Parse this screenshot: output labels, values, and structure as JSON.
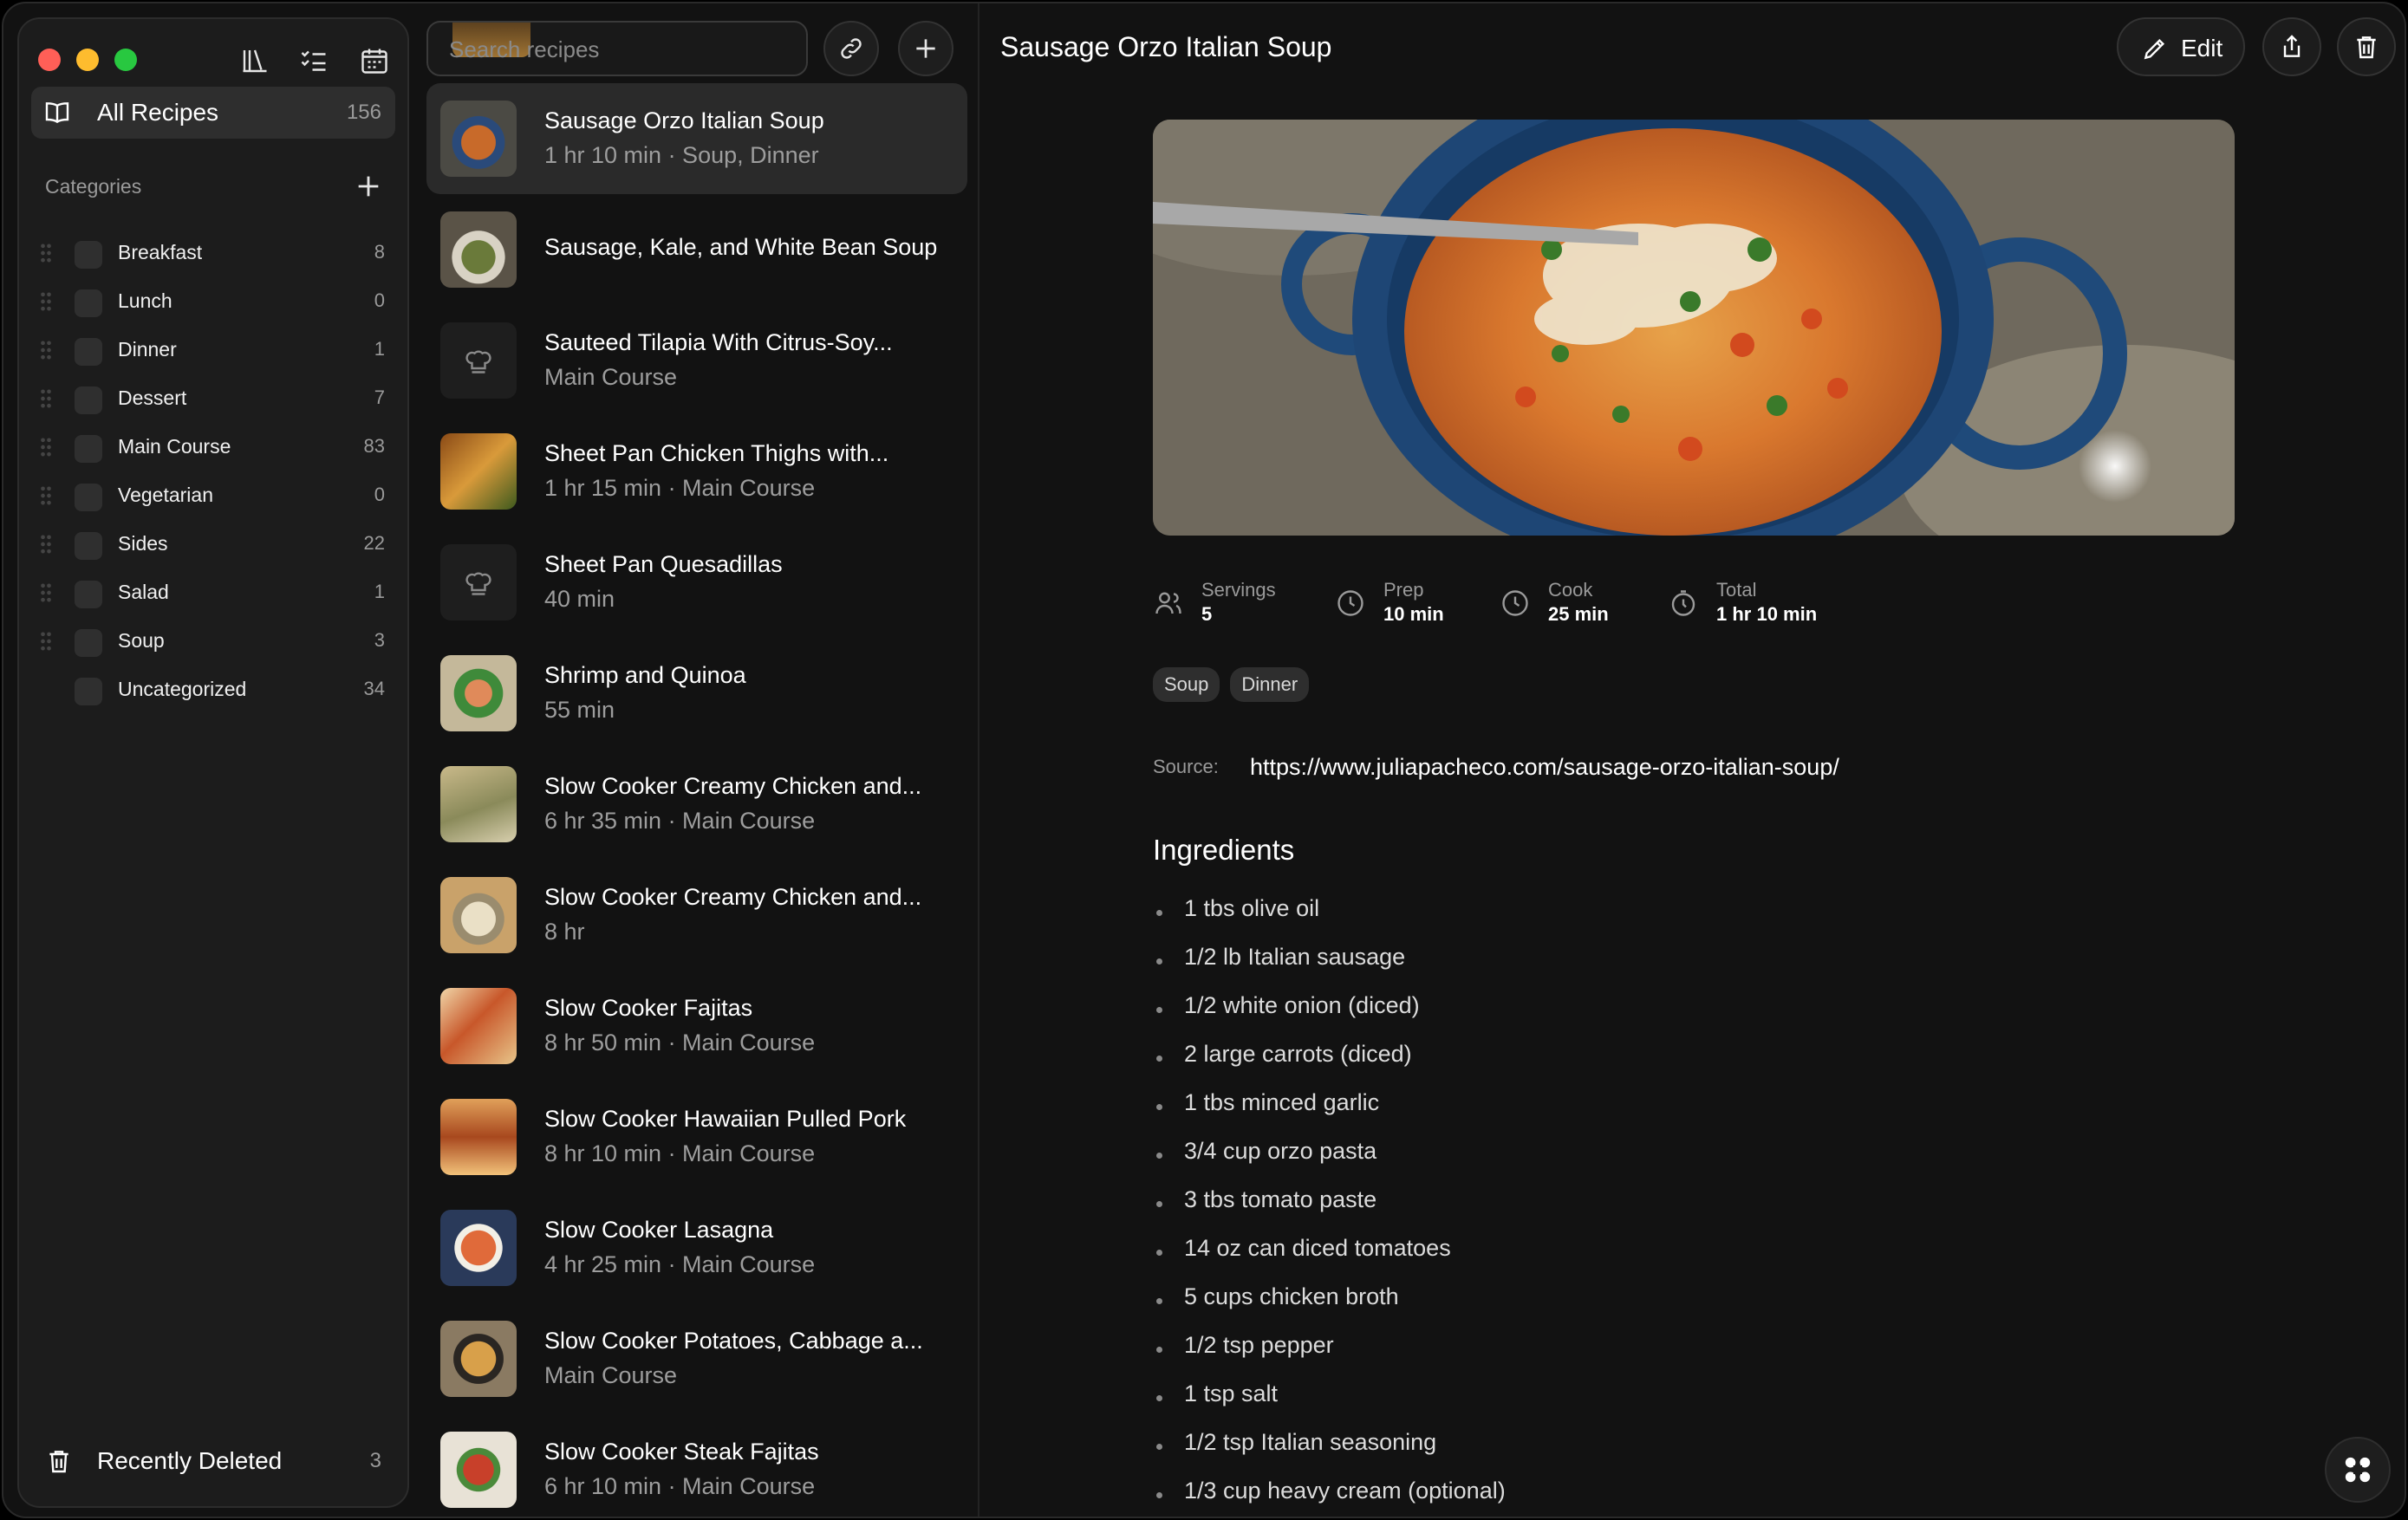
{
  "search": {
    "placeholder": "Search recipes"
  },
  "sidebar": {
    "all_recipes": {
      "label": "All Recipes",
      "count": "156"
    },
    "categories_header": "Categories",
    "categories": [
      {
        "label": "Breakfast",
        "count": "8"
      },
      {
        "label": "Lunch",
        "count": "0"
      },
      {
        "label": "Dinner",
        "count": "1"
      },
      {
        "label": "Dessert",
        "count": "7"
      },
      {
        "label": "Main Course",
        "count": "83"
      },
      {
        "label": "Vegetarian",
        "count": "0"
      },
      {
        "label": "Sides",
        "count": "22"
      },
      {
        "label": "Salad",
        "count": "1"
      },
      {
        "label": "Soup",
        "count": "3"
      },
      {
        "label": "Uncategorized",
        "count": "34"
      }
    ],
    "recently_deleted": {
      "label": "Recently Deleted",
      "count": "3"
    }
  },
  "recipes": [
    {
      "title": "Sausage Orzo Italian Soup",
      "subtitle": "1 hr 10 min · Soup, Dinner",
      "thumb": "soup"
    },
    {
      "title": "Sausage, Kale, and White Bean Soup",
      "subtitle": "",
      "thumb": "kale"
    },
    {
      "title": "Sauteed Tilapia With Citrus-Soy...",
      "subtitle": "Main Course",
      "thumb": "none"
    },
    {
      "title": "Sheet Pan Chicken Thighs with...",
      "subtitle": "1 hr 15 min · Main Course",
      "thumb": "chicken"
    },
    {
      "title": "Sheet Pan Quesadillas",
      "subtitle": "40 min",
      "thumb": "none"
    },
    {
      "title": "Shrimp and Quinoa",
      "subtitle": "55 min",
      "thumb": "shrimp"
    },
    {
      "title": "Slow Cooker Creamy Chicken and...",
      "subtitle": "6 hr 35 min · Main Course",
      "thumb": "creamy"
    },
    {
      "title": "Slow Cooker Creamy Chicken and...",
      "subtitle": "8 hr",
      "thumb": "creamy2"
    },
    {
      "title": "Slow Cooker Fajitas",
      "subtitle": "8 hr 50 min · Main Course",
      "thumb": "fajitas"
    },
    {
      "title": "Slow Cooker Hawaiian Pulled Pork",
      "subtitle": "8 hr 10 min · Main Course",
      "thumb": "pork"
    },
    {
      "title": "Slow Cooker Lasagna",
      "subtitle": "4 hr 25 min · Main Course",
      "thumb": "lasagna"
    },
    {
      "title": "Slow Cooker Potatoes, Cabbage a...",
      "subtitle": "Main Course",
      "thumb": "potatoes"
    },
    {
      "title": "Slow Cooker Steak Fajitas",
      "subtitle": "6 hr 10 min · Main Course",
      "thumb": "steak"
    }
  ],
  "detail": {
    "title": "Sausage Orzo Italian Soup",
    "edit_label": "Edit",
    "stats": [
      {
        "label": "Servings",
        "value": "5",
        "icon": "people-icon"
      },
      {
        "label": "Prep",
        "value": "10 min",
        "icon": "clock-icon"
      },
      {
        "label": "Cook",
        "value": "25 min",
        "icon": "clock-icon"
      },
      {
        "label": "Total",
        "value": "1 hr 10 min",
        "icon": "timer-icon"
      }
    ],
    "tags": [
      "Soup",
      "Dinner"
    ],
    "source_label": "Source:",
    "source_url": "https://www.juliapacheco.com/sausage-orzo-italian-soup/",
    "ingredients_title": "Ingredients",
    "ingredients": [
      "1 tbs olive oil",
      "1/2 lb Italian sausage",
      "1/2 white onion (diced)",
      "2 large carrots (diced)",
      "1 tbs minced garlic",
      "3/4 cup orzo pasta",
      "3 tbs tomato paste",
      "14 oz can diced tomatoes",
      "5 cups chicken broth",
      "1/2 tsp pepper",
      "1 tsp salt",
      "1/2 tsp Italian seasoning",
      "1/3 cup heavy cream (optional)"
    ]
  }
}
